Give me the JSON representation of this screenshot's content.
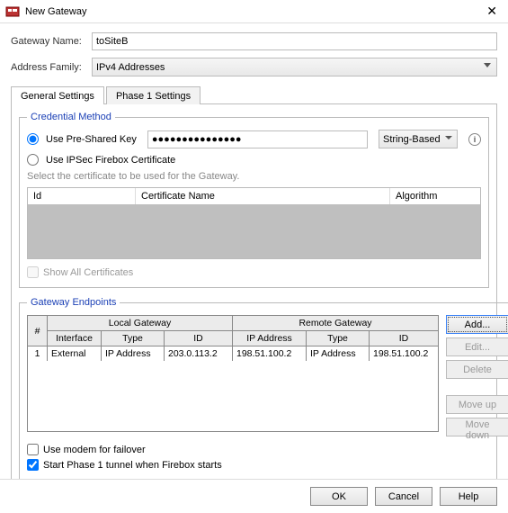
{
  "window": {
    "title": "New Gateway"
  },
  "form": {
    "gateway_name_label": "Gateway Name:",
    "gateway_name_value": "toSiteB",
    "address_family_label": "Address Family:",
    "address_family_value": "IPv4 Addresses"
  },
  "tabs": {
    "general": "General Settings",
    "phase1": "Phase 1 Settings"
  },
  "credential": {
    "legend": "Credential Method",
    "use_psk_label": "Use Pre-Shared Key",
    "psk_value": "●●●●●●●●●●●●●●●",
    "psk_mode": "String-Based",
    "use_cert_label": "Use IPSec Firebox Certificate",
    "hint": "Select the certificate to be used for the Gateway.",
    "cols": {
      "id": "Id",
      "name": "Certificate Name",
      "alg": "Algorithm"
    },
    "show_all_label": "Show All Certificates"
  },
  "endpoints": {
    "legend": "Gateway Endpoints",
    "col_num": "#",
    "group_local": "Local Gateway",
    "group_remote": "Remote Gateway",
    "cols": {
      "interface": "Interface",
      "type": "Type",
      "id": "ID",
      "ip": "IP Address",
      "rtype": "Type",
      "rid": "ID"
    },
    "rows": [
      {
        "n": "1",
        "interface": "External",
        "type": "IP Address",
        "id": "203.0.113.2",
        "ip": "198.51.100.2",
        "rtype": "IP Address",
        "rid": "198.51.100.2"
      }
    ],
    "buttons": {
      "add": "Add...",
      "edit": "Edit...",
      "delete": "Delete",
      "moveup": "Move up",
      "movedown": "Move down"
    }
  },
  "options": {
    "modem_failover": "Use modem for failover",
    "start_phase1": "Start Phase 1 tunnel when Firebox starts"
  },
  "footer": {
    "ok": "OK",
    "cancel": "Cancel",
    "help": "Help"
  }
}
